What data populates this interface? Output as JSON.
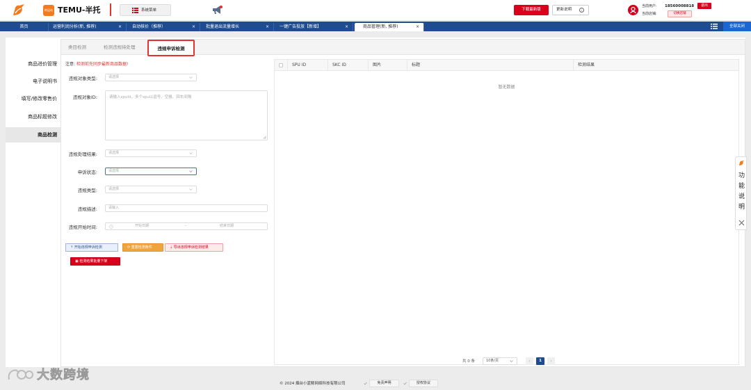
{
  "header": {
    "brand_badge": "转运站",
    "brand_name": "TEMU-半托",
    "system_menu_label": "系统菜单",
    "download_label": "下载最新版",
    "update_label": "更新说明",
    "current_user_label": "当前用户:",
    "current_user_value": "18560008818",
    "logout_label": "退出",
    "current_store_label": "当前店铺:",
    "switch_store_label": "切换店铺",
    "accent": "#d9001b"
  },
  "tabs": [
    {
      "label": "首页",
      "closable": false
    },
    {
      "label": "运营利润分析(新, 推荐)",
      "closable": true
    },
    {
      "label": "自动核价（推荐）",
      "closable": true
    },
    {
      "label": "批量退出流量增长",
      "closable": true
    },
    {
      "label": "一键广告投放【新增】",
      "closable": true
    },
    {
      "label": "商品管理(新, 推荐)",
      "closable": true,
      "active": true
    }
  ],
  "tab_close_symbol": "×",
  "close_all_label": "全部关闭",
  "sidebar": {
    "items": [
      {
        "label": "商品进价管理"
      },
      {
        "label": "电子说明书"
      },
      {
        "label": "填写/修改零售价"
      },
      {
        "label": "商品标题修改"
      },
      {
        "label": "商品检测",
        "active": true
      }
    ]
  },
  "subtabs": [
    {
      "label": "类目检测"
    },
    {
      "label": "检测违规待处理"
    },
    {
      "label": "违规申诉检测",
      "active": true
    }
  ],
  "notice": {
    "prefix": "注意:",
    "text": "检测前先同步最新商品数据!"
  },
  "form": {
    "object_type": {
      "label": "违规对象类型:",
      "placeholder": "请选择"
    },
    "object_id": {
      "label": "违规对象ID:",
      "placeholder": "请输入spuId，多个spu以逗号、空格、回车间隔"
    },
    "handle_result": {
      "label": "违规处理结果:",
      "placeholder": "请选择"
    },
    "appeal_status": {
      "label": "申诉状态:",
      "placeholder": "请选择"
    },
    "violation_type": {
      "label": "违规类型:",
      "placeholder": "请选择"
    },
    "description": {
      "label": "违规描述:",
      "placeholder": "请输入"
    },
    "start_time": {
      "label": "违规开始时间:",
      "start_placeholder": "开始日期",
      "separator": "-",
      "end_placeholder": "结束日期"
    }
  },
  "actions": {
    "start": "开始违规申诉检测",
    "reset": "重置检测条件",
    "export": "导出违规申诉检测结果",
    "batch_delist": "检测结果批量下架"
  },
  "table": {
    "columns": [
      "SPU ID",
      "SKC ID",
      "图片",
      "标题",
      "检测结果"
    ],
    "empty_text": "暂无数据"
  },
  "pagination": {
    "total": "共 0 条",
    "page_size": "10条/页",
    "prev": "‹",
    "current_page": "1",
    "next": "›"
  },
  "help_float": {
    "chars": [
      "功",
      "能",
      "说",
      "明"
    ]
  },
  "footer": {
    "copyright": "© 2024 烟台小蓝鲸网络科技有限公司",
    "disclaimer": "免责声明",
    "license": "授权协议"
  },
  "watermark": {
    "text": "大数跨境"
  }
}
